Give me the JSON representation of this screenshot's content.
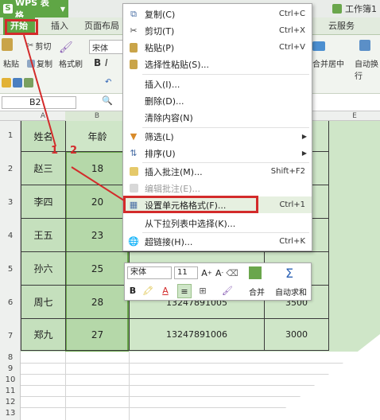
{
  "app": {
    "title": "WPS 表格",
    "doc_tab": "工作簿1"
  },
  "ribbon_tabs": [
    "开始",
    "插入",
    "页面布局",
    "云服务"
  ],
  "ribbon": {
    "paste_label": "粘贴",
    "cut_label": "剪切",
    "copy_label": "复制",
    "format_painter_label": "格式刷",
    "font_name": "宋体",
    "merge_center_label": "合并居中",
    "auto_wrap_label": "自动换行"
  },
  "name_box": "B2",
  "columns": [
    "A",
    "B",
    "E"
  ],
  "rows": [
    "1",
    "2",
    "3",
    "4",
    "5",
    "6",
    "7",
    "8",
    "9",
    "10",
    "11",
    "12",
    "13"
  ],
  "table": {
    "header": [
      "姓名",
      "年龄"
    ],
    "rows": [
      {
        "name": "赵三",
        "age": "18",
        "phone": "",
        "amount": ""
      },
      {
        "name": "李四",
        "age": "20",
        "phone": "",
        "amount": ""
      },
      {
        "name": "王五",
        "age": "23",
        "phone": "",
        "amount": ""
      },
      {
        "name": "孙六",
        "age": "25",
        "phone": "",
        "amount": ""
      },
      {
        "name": "周七",
        "age": "28",
        "phone": "13247891005",
        "amount": "3500"
      },
      {
        "name": "郑九",
        "age": "27",
        "phone": "13247891006",
        "amount": "3000"
      }
    ]
  },
  "context_menu": {
    "items": [
      {
        "label": "复制(C)",
        "shortcut": "Ctrl+C",
        "icon": "copy-icon"
      },
      {
        "label": "剪切(T)",
        "shortcut": "Ctrl+X",
        "icon": "scissors-icon"
      },
      {
        "label": "粘贴(P)",
        "shortcut": "Ctrl+V",
        "icon": "clipboard-icon"
      },
      {
        "label": "选择性粘贴(S)...",
        "shortcut": "",
        "icon": "paste-special-icon"
      },
      {
        "label": "插入(I)...",
        "shortcut": "",
        "icon": ""
      },
      {
        "label": "删除(D)...",
        "shortcut": "",
        "icon": ""
      },
      {
        "label": "清除内容(N)",
        "shortcut": "",
        "icon": ""
      },
      {
        "label": "筛选(L)",
        "shortcut": "",
        "icon": "filter-icon"
      },
      {
        "label": "排序(U)",
        "shortcut": "",
        "icon": "sort-icon"
      },
      {
        "label": "插入批注(M)...",
        "shortcut": "Shift+F2",
        "icon": "comment-icon"
      },
      {
        "label": "编辑批注(E)...",
        "shortcut": "",
        "icon": "edit-comment-icon"
      },
      {
        "label": "设置单元格格式(F)...",
        "shortcut": "Ctrl+1",
        "icon": "format-cells-icon"
      },
      {
        "label": "从下拉列表中选择(K)...",
        "shortcut": "",
        "icon": ""
      },
      {
        "label": "超链接(H)...",
        "shortcut": "Ctrl+K",
        "icon": "hyperlink-icon"
      }
    ]
  },
  "mini_toolbar": {
    "font_name": "宋体",
    "font_size": "11",
    "bold": "B",
    "merge_label": "合并",
    "autosum_label": "自动求和"
  },
  "annotations": {
    "num1": "1",
    "num2": "2"
  },
  "colors": {
    "accent_green": "#5fa645",
    "selection_green": "#cfe6c8",
    "annotation_red": "#d32b2b"
  }
}
